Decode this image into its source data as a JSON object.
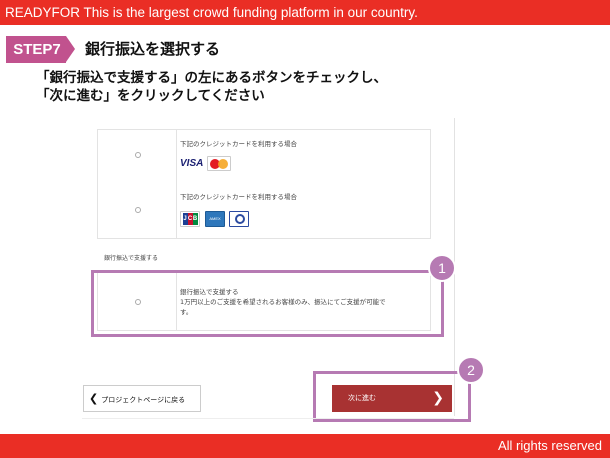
{
  "banner": {
    "top_text": "READYFOR This is the largest crowd funding platform in our country.",
    "bottom_text": "All rights reserved"
  },
  "step": {
    "badge": "STEP7",
    "title": "銀行振込を選択する",
    "instruction_line1": "「銀行振込で支援する」の左にあるボタンをチェックし、",
    "instruction_line2": "「次に進む」をクリックしてください"
  },
  "payment_options": {
    "card_option_1_label": "下記のクレジットカードを利用する場合",
    "card_option_2_label": "下記のクレジットカードを利用する場合",
    "card_logos_1": [
      "VISA",
      "MasterCard"
    ],
    "card_logos_2": [
      "JCB",
      "AMERICAN EXPRESS",
      "Diners Club"
    ],
    "visa_text": "VISA",
    "jcb_text": [
      "J",
      "C",
      "B"
    ],
    "amex_text": "AMEX",
    "section_label": "銀行振込で支援する",
    "bank_option_title": "銀行振込で支援する",
    "bank_option_desc_1": "1万円以上のご支援を希望されるお客様のみ、振込にてご支援が可能で",
    "bank_option_desc_2": "す。"
  },
  "callouts": {
    "one": "1",
    "two": "2"
  },
  "buttons": {
    "back_label": "プロジェクトページに戻る",
    "next_label": "次に進む"
  },
  "colors": {
    "banner_red": "#ea2e25",
    "step_pink": "#c1528e",
    "highlight_purple": "#b67ab3",
    "next_button": "#a83232"
  }
}
